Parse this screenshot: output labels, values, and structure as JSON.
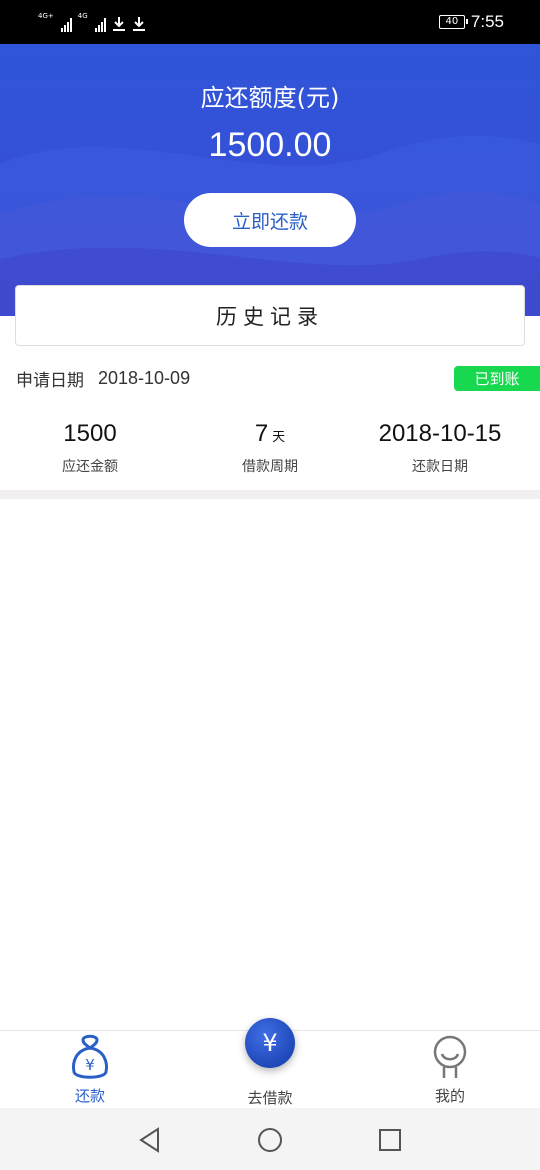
{
  "status_bar": {
    "network_1": "4G+",
    "network_2": "4G",
    "battery": "40",
    "time": "7:55"
  },
  "hero": {
    "title": "应还额度(元)",
    "amount": "1500.00",
    "repay_button": "立即还款"
  },
  "history": {
    "title": "历史记录"
  },
  "record": {
    "apply_label": "申请日期",
    "apply_date": "2018-10-09",
    "status": "已到账",
    "amount_value": "1500",
    "amount_label": "应还金额",
    "period_value": "7",
    "period_unit": "天",
    "period_label": "借款周期",
    "due_value": "2018-10-15",
    "due_label": "还款日期"
  },
  "tabs": {
    "repay": "还款",
    "borrow": "去借款",
    "mine": "我的"
  },
  "colors": {
    "hero_blue": "#3650d6",
    "accent": "#2b5fc8",
    "status_green": "#17d84e"
  },
  "icons": {
    "tab_repay": "money-bag-icon",
    "tab_borrow": "yuan-coin-icon",
    "tab_mine": "person-icon"
  }
}
